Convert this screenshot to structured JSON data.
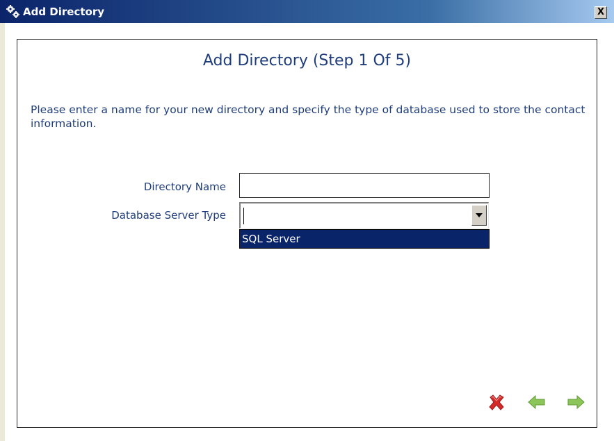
{
  "window": {
    "title": "Add Directory",
    "title_icon": "gears-icon",
    "close_label": "X"
  },
  "wizard": {
    "heading": "Add Directory (Step 1 Of 5)",
    "instructions": "Please enter a name for your new directory and specify the type of database used to store the contact information."
  },
  "form": {
    "directory_name": {
      "label": "Directory Name",
      "value": ""
    },
    "database_server_type": {
      "label": "Database Server Type",
      "value": "",
      "options": [
        "SQL Server"
      ]
    }
  },
  "buttons": {
    "cancel": {
      "icon": "red-x-cancel-icon"
    },
    "back": {
      "icon": "green-left-arrow-icon"
    },
    "next": {
      "icon": "green-right-arrow-icon"
    }
  },
  "colors": {
    "label_text": "#1f3d7a",
    "selection": "#0a246a",
    "title_gradient_start": "#0b246a",
    "title_gradient_end": "#a6caf0",
    "cancel_red": "#d42a2a",
    "arrow_green": "#7cbc4a"
  }
}
